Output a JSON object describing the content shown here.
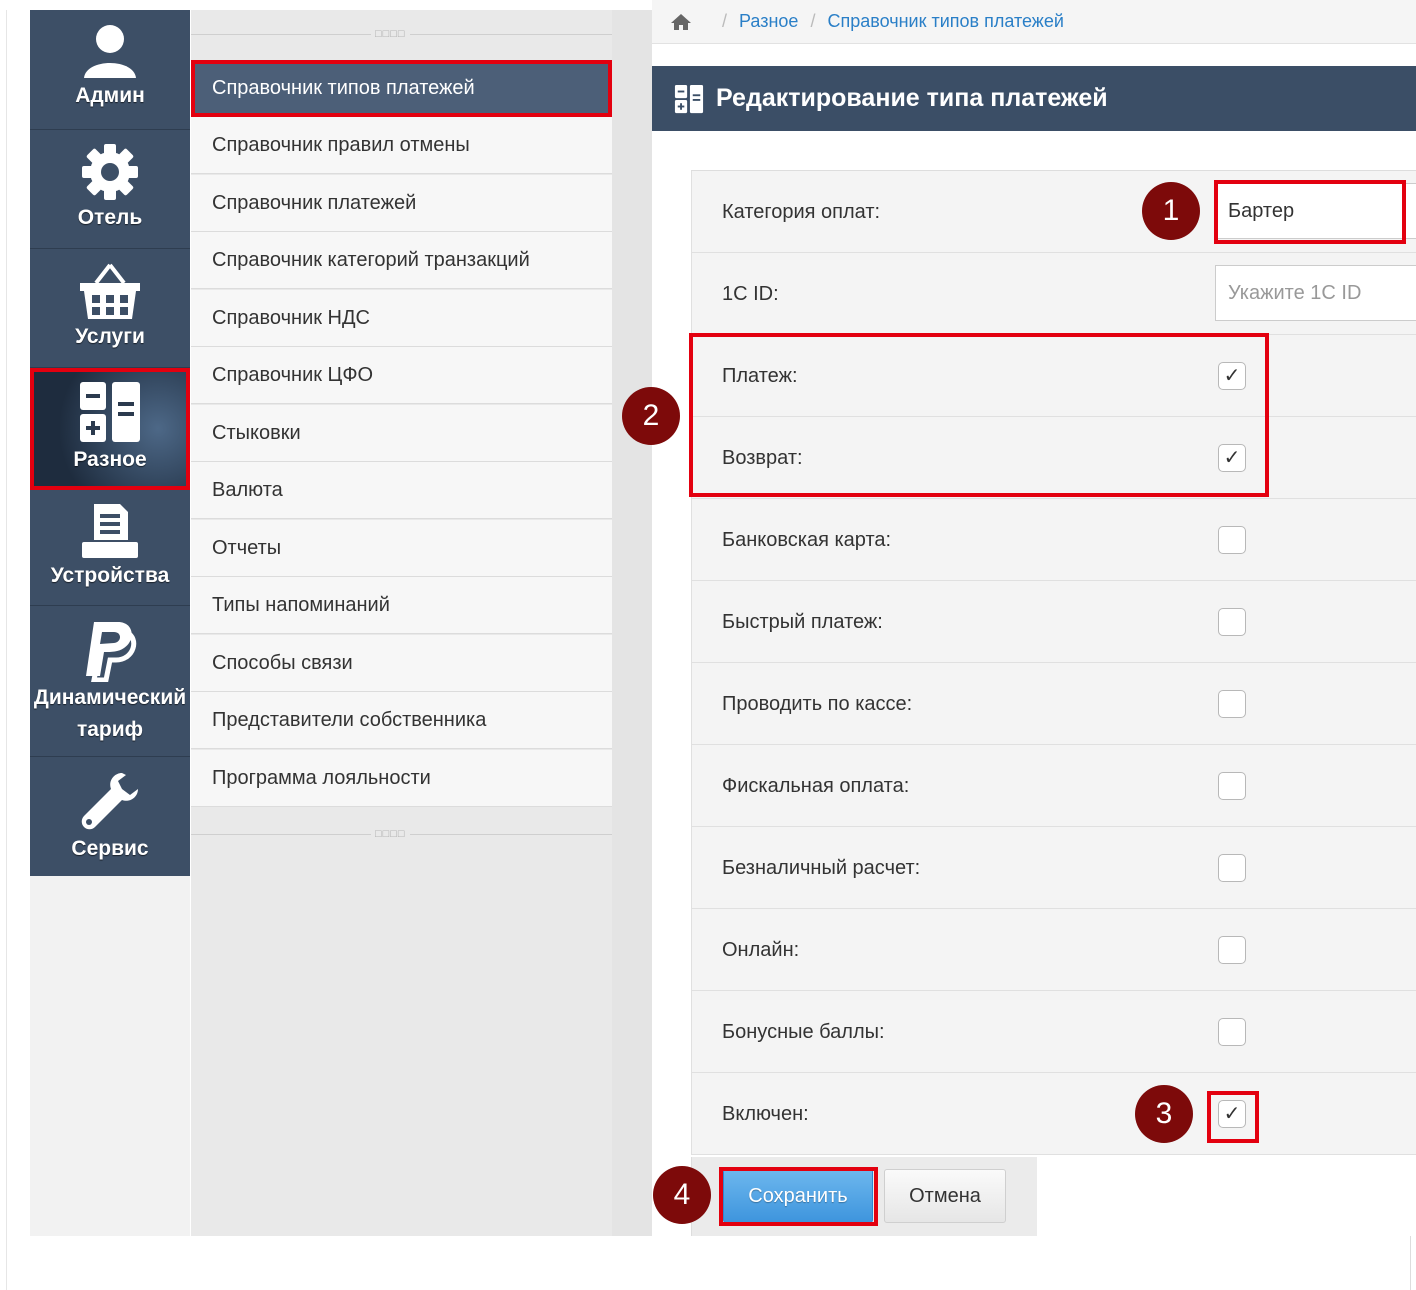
{
  "sidebar": {
    "items": [
      {
        "label": "Админ",
        "icon": "user-icon"
      },
      {
        "label": "Отель",
        "icon": "gear-icon"
      },
      {
        "label": "Услуги",
        "icon": "basket-icon"
      },
      {
        "label": "Разное",
        "icon": "misc-calculator-icon",
        "active": true
      },
      {
        "label": "Устройства",
        "icon": "printer-icon"
      },
      {
        "label": "Динамический тариф",
        "label_line1": "Динамический",
        "label_line2": "тариф",
        "icon": "paypal-icon"
      },
      {
        "label": "Сервис",
        "icon": "wrench-icon"
      }
    ]
  },
  "submenu": {
    "items": [
      "Справочник типов платежей",
      "Справочник правил отмены",
      "Справочник платежей",
      "Справочник категорий транзакций",
      "Справочник НДС",
      "Справочник ЦФО",
      "Стыковки",
      "Валюта",
      "Отчеты",
      "Типы напоминаний",
      "Способы связи",
      "Представители собственника",
      "Программа лояльности"
    ],
    "active_index": 0
  },
  "breadcrumb": {
    "items": [
      "Разное",
      "Справочник типов платежей"
    ]
  },
  "panel": {
    "title": "Редактирование типа платежей"
  },
  "form": {
    "category": {
      "label": "Категория оплат:",
      "value": "Бартер"
    },
    "onec": {
      "label": "1С ID:",
      "placeholder": "Укажите 1С ID"
    },
    "checkboxes": [
      {
        "label": "Платеж:",
        "checked": true
      },
      {
        "label": "Возврат:",
        "checked": true
      },
      {
        "label": "Банковская карта:",
        "checked": false
      },
      {
        "label": "Быстрый платеж:",
        "checked": false
      },
      {
        "label": "Проводить по кассе:",
        "checked": false
      },
      {
        "label": "Фискальная оплата:",
        "checked": false
      },
      {
        "label": "Безналичный расчет:",
        "checked": false
      },
      {
        "label": "Онлайн:",
        "checked": false
      },
      {
        "label": "Бонусные баллы:",
        "checked": false
      },
      {
        "label": "Включен:",
        "checked": true
      }
    ],
    "check_glyph": "✓"
  },
  "buttons": {
    "save": "Сохранить",
    "cancel": "Отмена"
  },
  "annotations": [
    "1",
    "2",
    "3",
    "4"
  ],
  "colors": {
    "highlight": "#e3000f",
    "badge": "#7d0a0a",
    "sidebar": "#3d4f66",
    "header": "#3b4e66",
    "save": "#3e95dd"
  }
}
